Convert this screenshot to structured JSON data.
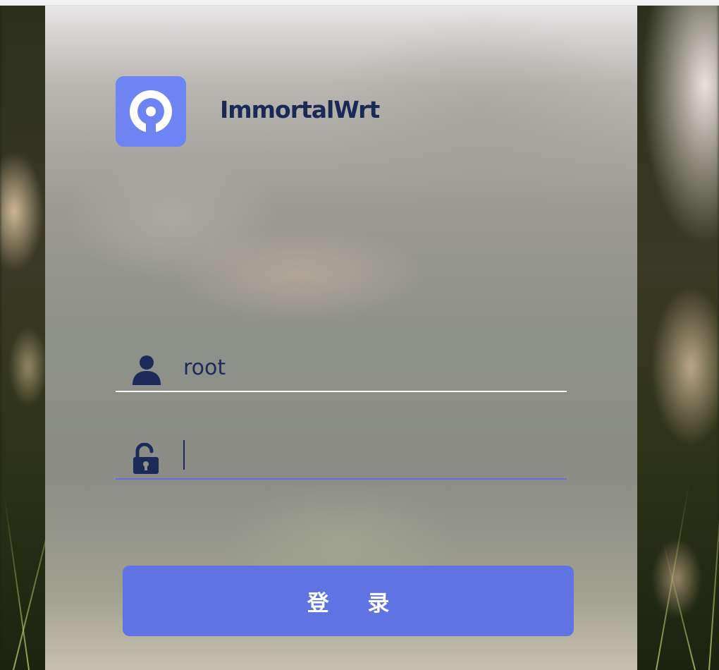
{
  "brand": {
    "name": "ImmortalWrt",
    "logo_icon": "immortalwrt-logo-icon",
    "accent_color": "#6f84f3"
  },
  "login_form": {
    "username": {
      "icon": "user-icon",
      "value": "root"
    },
    "password": {
      "icon": "unlock-icon",
      "value": ""
    },
    "submit_label": "登 录",
    "button_color": "#5f73e3"
  }
}
